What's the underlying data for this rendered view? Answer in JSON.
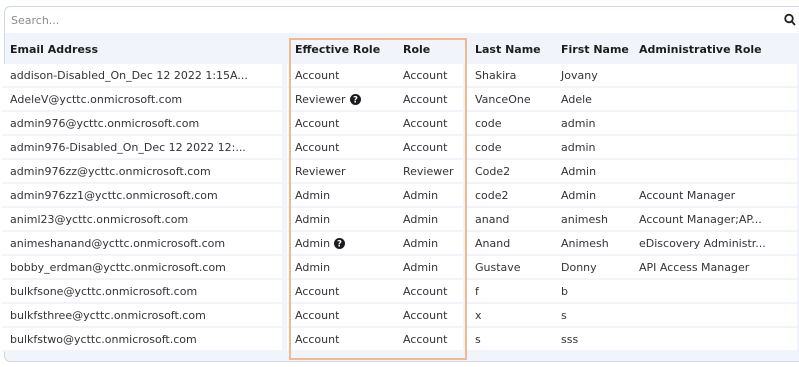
{
  "search": {
    "placeholder": "Search..."
  },
  "table": {
    "columns": [
      "Email Address",
      "Effective Role",
      "Role",
      "Last Name",
      "First Name",
      "Administrative Role"
    ],
    "rows": [
      {
        "email": "addison-Disabled_On_Dec 12 2022 1:15A...",
        "effective_role": "Account",
        "role": "Account",
        "last_name": "Shakira",
        "first_name": "Jovany",
        "admin_role": "",
        "info": false
      },
      {
        "email": "AdeleV@ycttc.onmicrosoft.com",
        "effective_role": "Reviewer",
        "role": "Account",
        "last_name": "VanceOne",
        "first_name": "Adele",
        "admin_role": "",
        "info": true
      },
      {
        "email": "admin976@ycttc.onmicrosoft.com",
        "effective_role": "Account",
        "role": "Account",
        "last_name": "code",
        "first_name": "admin",
        "admin_role": "",
        "info": false
      },
      {
        "email": "admin976-Disabled_On_Dec 12 2022 12:...",
        "effective_role": "Account",
        "role": "Account",
        "last_name": "code",
        "first_name": "admin",
        "admin_role": "",
        "info": false
      },
      {
        "email": "admin976zz@ycttc.onmicrosoft.com",
        "effective_role": "Reviewer",
        "role": "Reviewer",
        "last_name": "Code2",
        "first_name": "Admin",
        "admin_role": "",
        "info": false
      },
      {
        "email": "admin976zz1@ycttc.onmicrosoft.com",
        "effective_role": "Admin",
        "role": "Admin",
        "last_name": "code2",
        "first_name": "Admin",
        "admin_role": "Account Manager",
        "info": false
      },
      {
        "email": "animl23@ycttc.onmicrosoft.com",
        "effective_role": "Admin",
        "role": "Admin",
        "last_name": "anand",
        "first_name": "animesh",
        "admin_role": "Account Manager;AP...",
        "info": false
      },
      {
        "email": "animeshanand@ycttc.onmicrosoft.com",
        "effective_role": "Admin",
        "role": "Admin",
        "last_name": "Anand",
        "first_name": "Animesh",
        "admin_role": "eDiscovery Administr...",
        "info": true
      },
      {
        "email": "bobby_erdman@ycttc.onmicrosoft.com",
        "effective_role": "Admin",
        "role": "Admin",
        "last_name": "Gustave",
        "first_name": "Donny",
        "admin_role": "API Access Manager",
        "info": false
      },
      {
        "email": "bulkfsone@ycttc.onmicrosoft.com",
        "effective_role": "Account",
        "role": "Account",
        "last_name": "f",
        "first_name": "b",
        "admin_role": "",
        "info": false
      },
      {
        "email": "bulkfsthree@ycttc.onmicrosoft.com",
        "effective_role": "Account",
        "role": "Account",
        "last_name": "x",
        "first_name": "s",
        "admin_role": "",
        "info": false
      },
      {
        "email": "bulkfstwo@ycttc.onmicrosoft.com",
        "effective_role": "Account",
        "role": "Account",
        "last_name": "s",
        "first_name": "sss",
        "admin_role": "",
        "info": false
      }
    ]
  },
  "colors": {
    "panel_bg": "#f1f5fb",
    "highlight_border": "#f2b98e"
  },
  "icons": {
    "search": "search-icon",
    "info": "info-icon"
  }
}
